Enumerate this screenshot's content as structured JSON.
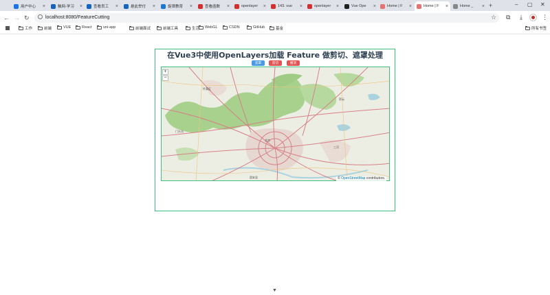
{
  "browser": {
    "tabs": [
      {
        "label": "用户中心",
        "color": "#1a73e8",
        "active": false
      },
      {
        "label": "触网-学习",
        "color": "#1565c0",
        "active": false
      },
      {
        "label": "查看员工",
        "color": "#1565c0",
        "active": false
      },
      {
        "label": "悬此举付",
        "color": "#1565c0",
        "active": false
      },
      {
        "label": "旋律教育",
        "color": "#1976d2",
        "active": false
      },
      {
        "label": "查看函数",
        "color": "#d32f2f",
        "active": false
      },
      {
        "label": "openlayer",
        "color": "#d32f2f",
        "active": false
      },
      {
        "label": "143. vue",
        "color": "#d32f2f",
        "active": false
      },
      {
        "label": "openlayer",
        "color": "#d32f2f",
        "active": false
      },
      {
        "label": "Vue Ope",
        "color": "#222222",
        "active": false
      },
      {
        "label": "Home | F",
        "color": "#e57373",
        "active": false
      },
      {
        "label": "Home | F",
        "color": "#e57373",
        "active": true
      },
      {
        "label": "Home _",
        "color": "#888888",
        "active": false
      }
    ],
    "tab_close": "×",
    "new_tab": "+",
    "window": {
      "minimize": "–",
      "maximize": "▢",
      "close": "✕"
    },
    "url": "localhost:8080/FeatureCutting",
    "bookmarks": [
      "工作",
      "前端",
      "VUE",
      "React",
      "uni-app",
      "前端面试",
      "前端工具",
      "生活",
      "WebGL",
      "CSDN",
      "GitHub",
      "基金"
    ],
    "all_bookmarks": "所有书签"
  },
  "page": {
    "title": "在Vue3中使用OpenLayers加载 Feature 做剪切、遮罩处理",
    "buttons": [
      {
        "label": "遮罩",
        "color": "#4a9be3"
      },
      {
        "label": "剪切",
        "color": "#e05555"
      },
      {
        "label": "撤消",
        "color": "#e05555"
      }
    ],
    "map": {
      "zoom_in": "+",
      "zoom_out": "−",
      "attribution_prefix": "© ",
      "attribution_link": "OpenStreetMap",
      "attribution_suffix": " contributors."
    },
    "colors": {
      "accent": "#3fbf7f",
      "forest": "#a8d18d",
      "urban": "#e6d8d0",
      "road": "#d77f86",
      "water": "#aad3df"
    }
  },
  "icons": {
    "back": "arrow-left-icon",
    "forward": "arrow-right-icon",
    "reload": "reload-icon",
    "info": "site-info-icon",
    "star": "bookmark-star-icon",
    "extensions": "puzzle-icon",
    "downloads": "download-icon",
    "menu": "kebab-menu-icon",
    "scroll": "scroll-down-icon"
  }
}
